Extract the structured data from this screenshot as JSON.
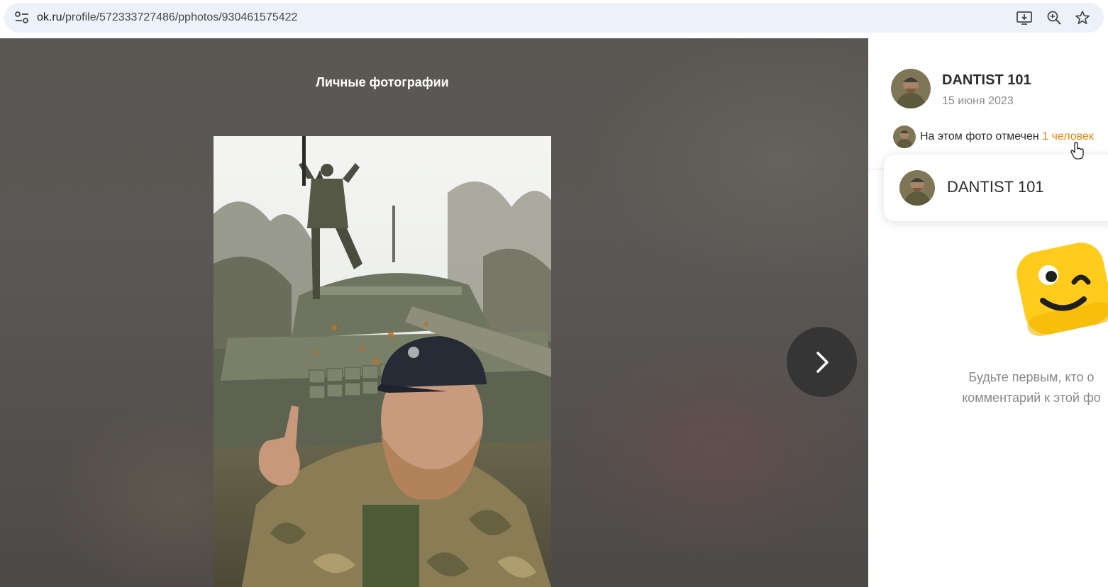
{
  "browser": {
    "url_host": "ok.ru",
    "url_path": "/profile/572333727486/pphotos/930461575422",
    "icons": [
      "site-info-icon",
      "install-app-icon",
      "zoom-icon",
      "bookmark-star-icon"
    ]
  },
  "viewer": {
    "album_title": "Личные фотографии",
    "next_icon": "chevron-right-icon"
  },
  "side_panel": {
    "author_name": "DANTIST 101",
    "date": "15 июня 2023",
    "tag_prefix": "На этом фото отмечен",
    "tag_link": "1 человек",
    "tag_popup": {
      "name": "DANTIST 101"
    },
    "empty_comments_line1": "Будьте первым, кто о",
    "empty_comments_line2": "комментарий к этой фо"
  },
  "colors": {
    "accent_orange": "#ee8208",
    "mascot_yellow": "#ffcc1d",
    "text_primary": "#2c2d2e",
    "text_secondary": "#87898f"
  }
}
